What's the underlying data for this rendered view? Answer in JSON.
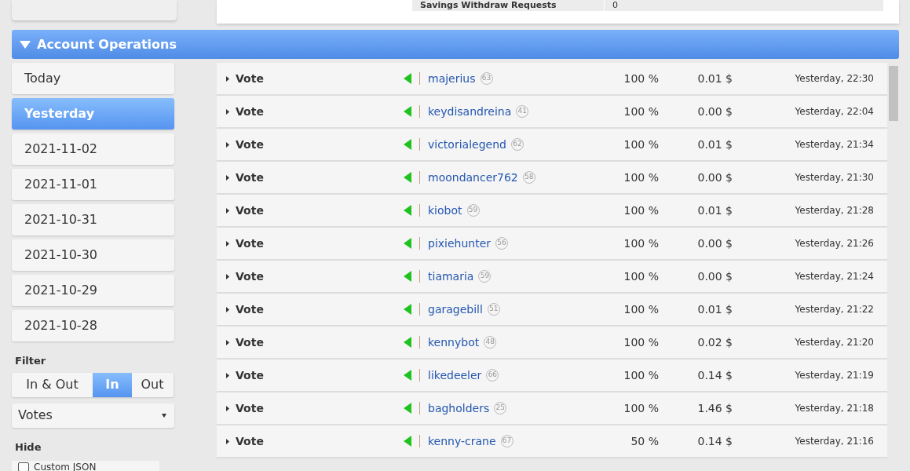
{
  "top_table": {
    "rows": [
      {
        "label": "Savings Withdraw Requests",
        "value": "0"
      }
    ]
  },
  "section": {
    "title": "Account Operations",
    "expanded": true
  },
  "dates": [
    {
      "label": "Today",
      "selected": false
    },
    {
      "label": "Yesterday",
      "selected": true
    },
    {
      "label": "2021-11-02",
      "selected": false
    },
    {
      "label": "2021-11-01",
      "selected": false
    },
    {
      "label": "2021-10-31",
      "selected": false
    },
    {
      "label": "2021-10-30",
      "selected": false
    },
    {
      "label": "2021-10-29",
      "selected": false
    },
    {
      "label": "2021-10-28",
      "selected": false
    }
  ],
  "filter": {
    "label": "Filter",
    "options": [
      {
        "label": "In & Out",
        "selected": false
      },
      {
        "label": "In",
        "selected": true
      },
      {
        "label": "Out",
        "selected": false
      }
    ],
    "select": "Votes"
  },
  "hide": {
    "label": "Hide",
    "items": [
      {
        "label": "Custom JSON",
        "checked": false
      }
    ]
  },
  "operations": [
    {
      "type": "Vote",
      "kind": "in",
      "user": "majerius",
      "reputation": "63",
      "percent": "100 %",
      "amount": "0.01 $",
      "time": "Yesterday, 22:30"
    },
    {
      "type": "Vote",
      "kind": "in",
      "user": "keydisandreina",
      "reputation": "41",
      "percent": "100 %",
      "amount": "0.00 $",
      "time": "Yesterday, 22:04"
    },
    {
      "type": "Vote",
      "kind": "in",
      "user": "victorialegend",
      "reputation": "62",
      "percent": "100 %",
      "amount": "0.01 $",
      "time": "Yesterday, 21:34"
    },
    {
      "type": "Vote",
      "kind": "in",
      "user": "moondancer762",
      "reputation": "58",
      "percent": "100 %",
      "amount": "0.00 $",
      "time": "Yesterday, 21:30"
    },
    {
      "type": "Vote",
      "kind": "in",
      "user": "kiobot",
      "reputation": "59",
      "percent": "100 %",
      "amount": "0.01 $",
      "time": "Yesterday, 21:28"
    },
    {
      "type": "Vote",
      "kind": "in",
      "user": "pixiehunter",
      "reputation": "56",
      "percent": "100 %",
      "amount": "0.00 $",
      "time": "Yesterday, 21:26"
    },
    {
      "type": "Vote",
      "kind": "in",
      "user": "tiamaria",
      "reputation": "59",
      "percent": "100 %",
      "amount": "0.00 $",
      "time": "Yesterday, 21:24"
    },
    {
      "type": "Vote",
      "kind": "in",
      "user": "garagebill",
      "reputation": "51",
      "percent": "100 %",
      "amount": "0.01 $",
      "time": "Yesterday, 21:22"
    },
    {
      "type": "Vote",
      "kind": "in",
      "user": "kennybot",
      "reputation": "48",
      "percent": "100 %",
      "amount": "0.02 $",
      "time": "Yesterday, 21:20"
    },
    {
      "type": "Vote",
      "kind": "in",
      "user": "likedeeler",
      "reputation": "66",
      "percent": "100 %",
      "amount": "0.14 $",
      "time": "Yesterday, 21:19"
    },
    {
      "type": "Vote",
      "kind": "in",
      "user": "bagholders",
      "reputation": "25",
      "percent": "100 %",
      "amount": "1.46 $",
      "time": "Yesterday, 21:18"
    },
    {
      "type": "Vote",
      "kind": "in",
      "user": "kenny-crane",
      "reputation": "67",
      "percent": "50 %",
      "amount": "0.14 $",
      "time": "Yesterday, 21:16"
    }
  ]
}
